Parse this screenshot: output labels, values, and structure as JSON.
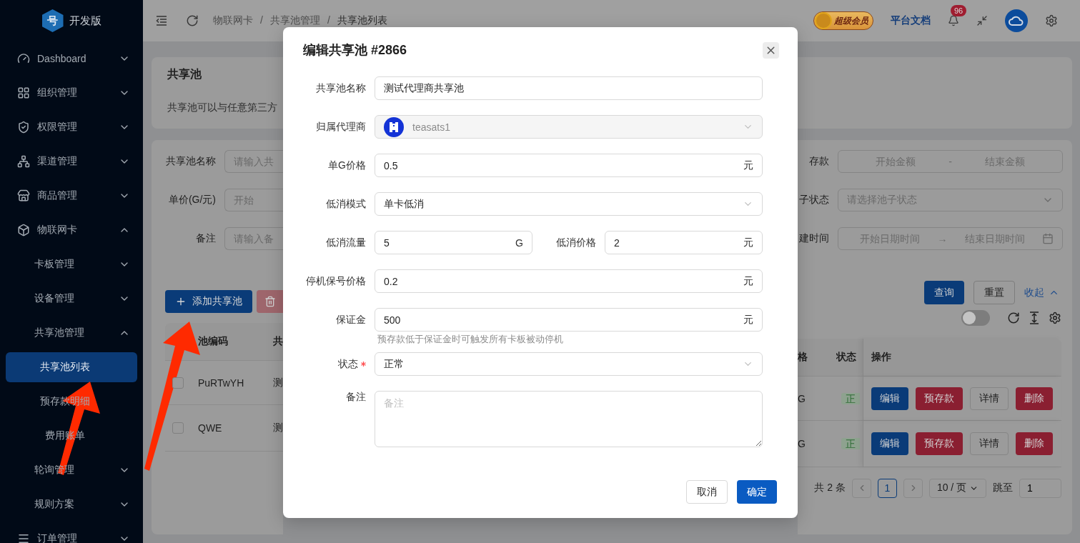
{
  "sidebar": {
    "logo_glyph": "号",
    "logo_text": "开发版",
    "items": [
      {
        "label": "Dashboard",
        "selected": false,
        "expanded": false
      },
      {
        "label": "组织管理",
        "selected": false,
        "expanded": false
      },
      {
        "label": "权限管理",
        "selected": false,
        "expanded": false
      },
      {
        "label": "渠道管理",
        "selected": false,
        "expanded": false
      },
      {
        "label": "商品管理",
        "selected": false,
        "expanded": false
      },
      {
        "label": "物联网卡",
        "selected": false,
        "expanded": true,
        "children": [
          {
            "label": "卡板管理",
            "selected": false,
            "expanded": false
          },
          {
            "label": "设备管理",
            "selected": false,
            "expanded": false
          },
          {
            "label": "共享池管理",
            "selected": false,
            "expanded": true,
            "children": [
              {
                "label": "共享池列表",
                "selected": true
              },
              {
                "label": "预存款明细",
                "selected": false
              },
              {
                "label": "费用账单",
                "selected": false
              }
            ]
          },
          {
            "label": "轮询管理",
            "selected": false,
            "expanded": false
          },
          {
            "label": "规则方案",
            "selected": false,
            "expanded": false
          }
        ]
      },
      {
        "label": "订单管理",
        "selected": false,
        "expanded": false
      }
    ]
  },
  "header": {
    "breadcrumb": [
      {
        "kind": "item",
        "label": "物联网卡"
      },
      {
        "kind": "separator",
        "label": "/"
      },
      {
        "kind": "item",
        "label": "共享池管理"
      },
      {
        "kind": "separator",
        "label": "/"
      },
      {
        "kind": "item",
        "label": "共享池列表"
      }
    ],
    "vip_badge": "超级会员",
    "docs_link": "平台文档",
    "notification_count": "96"
  },
  "page": {
    "title": "共享池",
    "description": "共享池可以与任意第三方"
  },
  "filters_left": [
    {
      "label": "共享池名称",
      "placeholder": "请输入共"
    },
    {
      "label": "单价(G/元)",
      "placeholder": "开始"
    },
    {
      "label": "备注",
      "placeholder": "请输入备"
    }
  ],
  "filters_right": [
    {
      "kind": "range",
      "label": "存款",
      "start_placeholder": "开始金额",
      "separator": "-",
      "end_placeholder": "结束金额"
    },
    {
      "kind": "select",
      "label": "子状态",
      "placeholder": "请选择池子状态"
    },
    {
      "kind": "daterange",
      "label": "建时间",
      "start_placeholder": "开始日期时间",
      "separator": "→",
      "end_placeholder": "结束日期时间"
    }
  ],
  "actions": {
    "add_button": "添加共享池",
    "search_button": "查询",
    "reset_button": "重置",
    "collapse_link": "收起"
  },
  "toolbar": {
    "toggle_on": false
  },
  "table": {
    "columns_left": [
      "池编码",
      "共"
    ],
    "columns_right": [
      "格",
      "状态",
      "操作"
    ],
    "rows": [
      {
        "checked": false,
        "cells": [
          "PuRTwYH",
          "测",
          "G",
          "正"
        ],
        "actions": [
          {
            "label": "编辑",
            "kind": "primary"
          },
          {
            "label": "预存款",
            "kind": "danger"
          },
          {
            "label": "详情",
            "kind": "default"
          },
          {
            "label": "删除",
            "kind": "danger"
          }
        ]
      },
      {
        "checked": false,
        "cells": [
          "QWE",
          "测",
          "G",
          "正"
        ],
        "actions": [
          {
            "label": "编辑",
            "kind": "primary"
          },
          {
            "label": "预存款",
            "kind": "danger"
          },
          {
            "label": "详情",
            "kind": "default"
          },
          {
            "label": "删除",
            "kind": "danger"
          }
        ]
      }
    ]
  },
  "pagination": {
    "total": "共 2 条",
    "pages": [
      {
        "label": "1",
        "selected": true
      }
    ],
    "page_size": "10 / 页",
    "jump_label": "跳至",
    "jump_value": "1"
  },
  "modal": {
    "title": "编辑共享池 #2866",
    "fields": [
      {
        "kind": "text",
        "label": "共享池名称",
        "value": "测试代理商共享池"
      },
      {
        "kind": "avatar-select",
        "label": "归属代理商",
        "value": "teasats1",
        "disabled": true
      },
      {
        "kind": "text",
        "label": "单G价格",
        "value": "0.5",
        "suffix": "元"
      },
      {
        "kind": "select",
        "label": "低消模式",
        "value": "单卡低消",
        "disabled": false
      },
      {
        "kind": "pair",
        "items": [
          {
            "label": "低消流量",
            "value": "5",
            "suffix": "G"
          },
          {
            "label": "低消价格",
            "value": "2",
            "suffix": "元"
          }
        ]
      },
      {
        "kind": "text",
        "label": "停机保号价格",
        "value": "0.2",
        "suffix": "元"
      },
      {
        "kind": "text",
        "label": "保证金",
        "value": "500",
        "suffix": "元",
        "hint": "预存款低于保证金时可触发所有卡板被动停机"
      },
      {
        "kind": "select",
        "label": "状态",
        "value": "正常",
        "disabled": false,
        "required": true
      },
      {
        "kind": "textarea",
        "label": "备注",
        "placeholder": "备注"
      }
    ],
    "cancel_button": "取消",
    "ok_button": "确定"
  }
}
